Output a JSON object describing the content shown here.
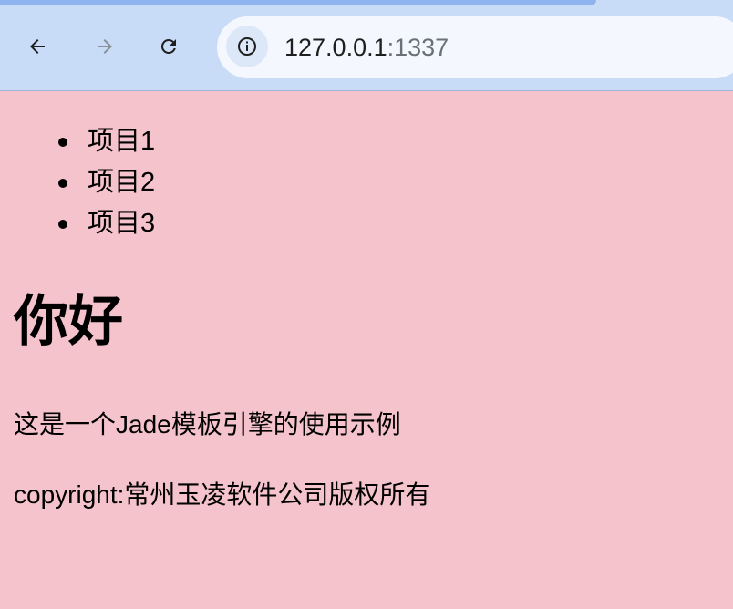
{
  "browser": {
    "address_bar": {
      "host": "127.0.0.1",
      "port": ":1337"
    },
    "icons": {
      "back": "back-arrow-icon",
      "forward": "forward-arrow-icon",
      "reload": "reload-icon",
      "site_info": "info-icon"
    },
    "colors": {
      "toolbar_background": "#c9dcf7",
      "tab_strip": "#8fb3ee",
      "omnibox_background": "#f4f8fe",
      "page_background": "#f5c3cb"
    }
  },
  "page": {
    "list_items": [
      {
        "label": "项目1"
      },
      {
        "label": "项目2"
      },
      {
        "label": "项目3"
      }
    ],
    "heading": "你好",
    "description": "这是一个Jade模板引擎的使用示例",
    "copyright": "copyright:常州玉凌软件公司版权所有"
  }
}
